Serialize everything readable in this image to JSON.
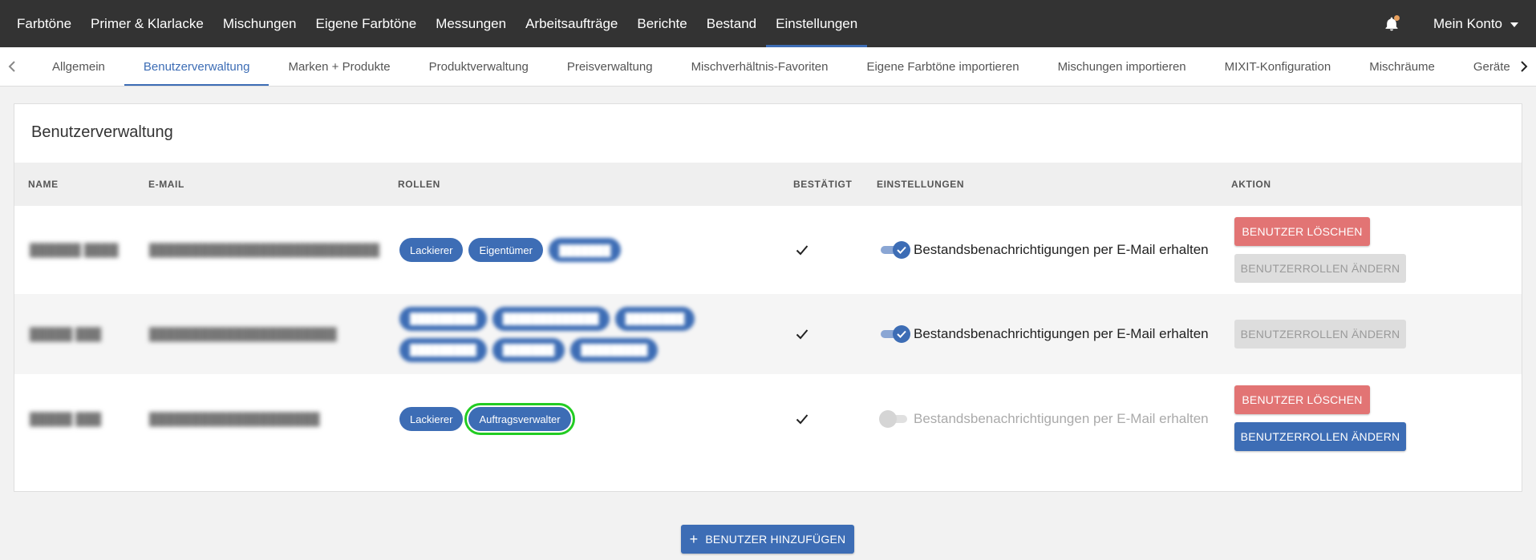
{
  "topnav": {
    "items": [
      "Farbtöne",
      "Primer & Klarlacke",
      "Mischungen",
      "Eigene Farbtöne",
      "Messungen",
      "Arbeitsaufträge",
      "Berichte",
      "Bestand",
      "Einstellungen"
    ],
    "active": "Einstellungen",
    "account_label": "Mein Konto"
  },
  "subtabs": {
    "items": [
      "Allgemein",
      "Benutzerverwaltung",
      "Marken + Produkte",
      "Produktverwaltung",
      "Preisverwaltung",
      "Mischverhältnis-Favoriten",
      "Eigene Farbtöne importieren",
      "Mischungen importieren",
      "MIXIT-Konfiguration",
      "Mischräume",
      "Geräte"
    ],
    "active": "Benutzerverwaltung"
  },
  "card": {
    "title": "Benutzerverwaltung",
    "columns": [
      "NAME",
      "E-MAIL",
      "ROLLEN",
      "BESTÄTIGT",
      "EINSTELLUNGEN",
      "AKTION"
    ]
  },
  "rows": [
    {
      "roles": [
        "Lackierer",
        "Eigentümer"
      ],
      "setting_label": "Bestandsbenachrichtigungen per E-Mail erhalten",
      "setting_enabled": true,
      "actions": [
        "BENUTZER LÖSCHEN",
        "BENUTZERROLLEN ÄNDERN"
      ]
    },
    {
      "roles": [],
      "setting_label": "Bestandsbenachrichtigungen per E-Mail erhalten",
      "setting_enabled": true,
      "actions": [
        "BENUTZERROLLEN ÄNDERN"
      ]
    },
    {
      "roles": [
        "Lackierer",
        "Auftragsverwalter"
      ],
      "setting_label": "Bestandsbenachrichtigungen per E-Mail erhalten",
      "setting_enabled": false,
      "actions": [
        "BENUTZER LÖSCHEN",
        "BENUTZERROLLEN ÄNDERN"
      ]
    }
  ],
  "add_button_label": "BENUTZER HINZUFÜGEN",
  "colors": {
    "primary": "#3d6db5",
    "danger": "#e27474",
    "topbar": "#333333",
    "highlight": "#22cc22"
  }
}
